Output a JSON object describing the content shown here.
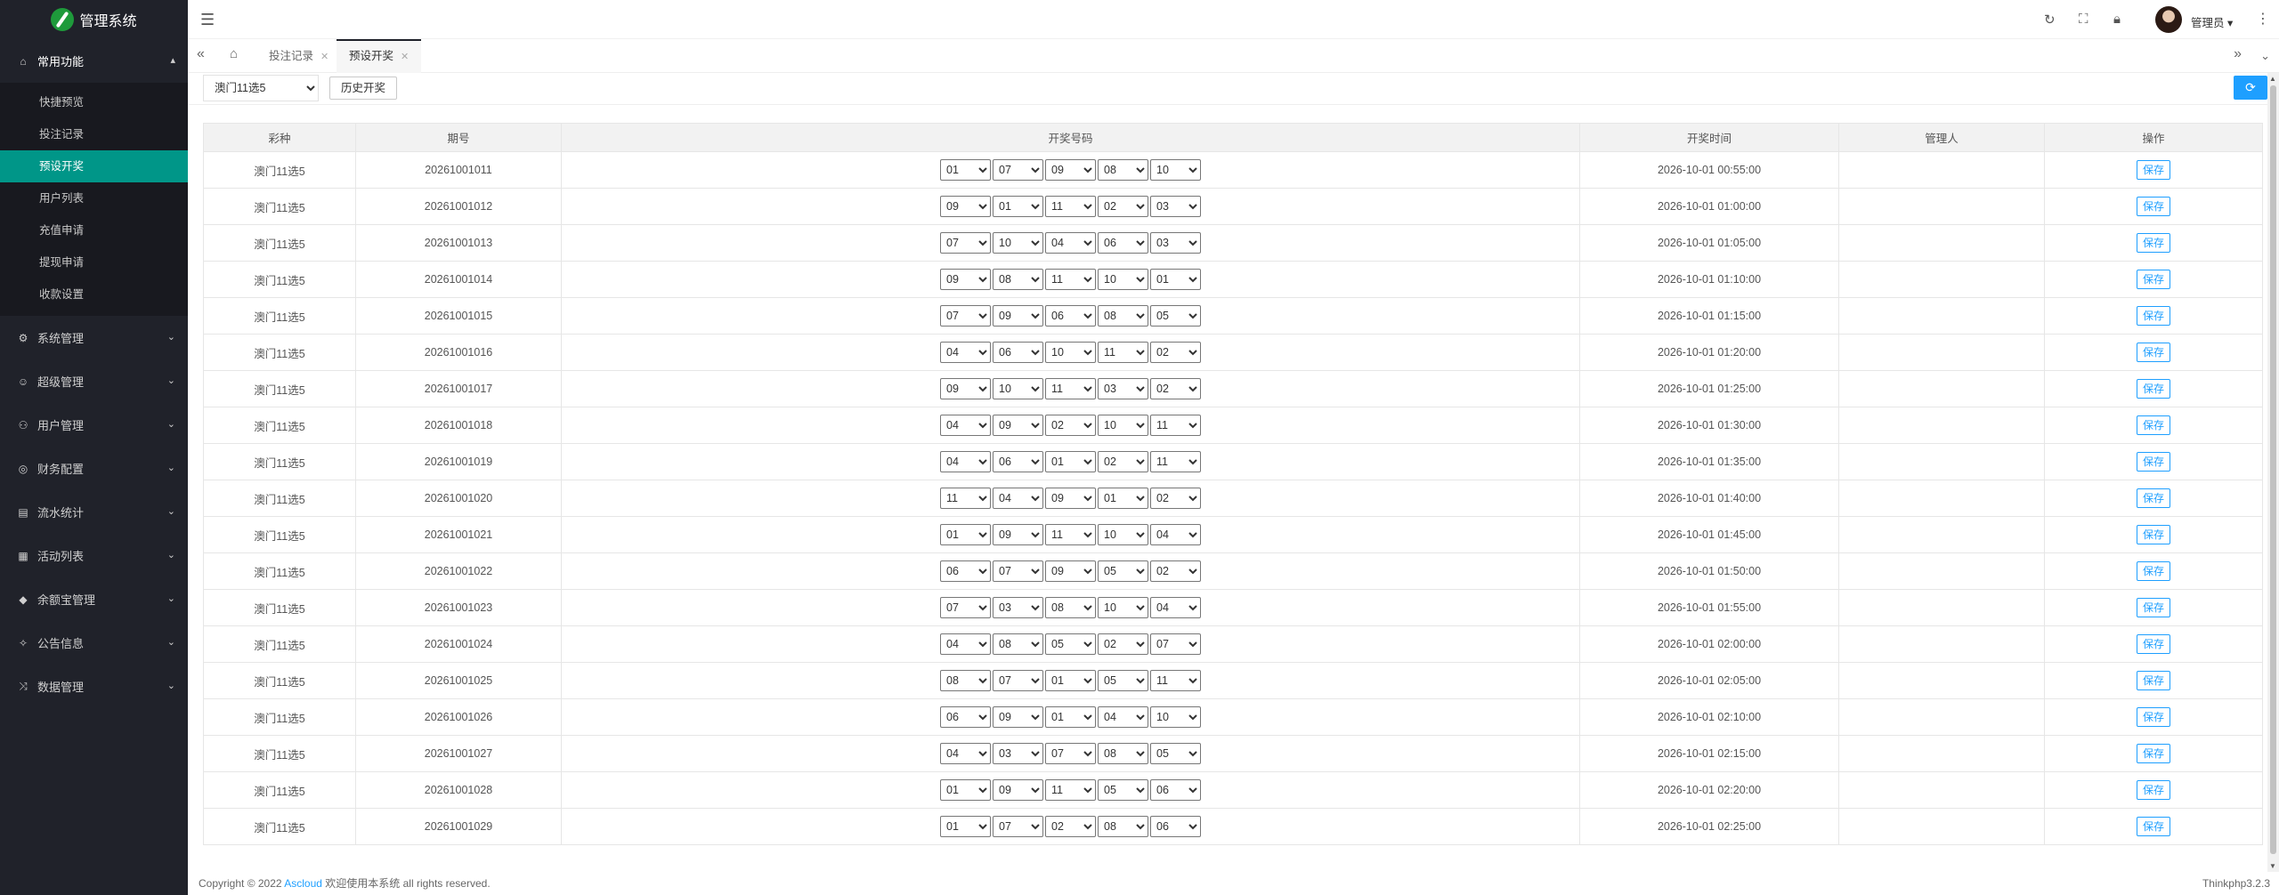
{
  "app": {
    "title": "管理系统"
  },
  "sidebar": {
    "open_group": {
      "label": "常用功能",
      "icon": "home-icon"
    },
    "sub_items": [
      {
        "label": "快捷预览"
      },
      {
        "label": "投注记录"
      },
      {
        "label": "预设开奖",
        "active": true
      },
      {
        "label": "用户列表"
      },
      {
        "label": "充值申请"
      },
      {
        "label": "提现申请"
      },
      {
        "label": "收款设置"
      }
    ],
    "groups": [
      {
        "label": "系统管理",
        "icon": "gear-icon"
      },
      {
        "label": "超级管理",
        "icon": "user-icon"
      },
      {
        "label": "用户管理",
        "icon": "users-icon"
      },
      {
        "label": "财务配置",
        "icon": "finance-icon"
      },
      {
        "label": "流水统计",
        "icon": "stats-icon"
      },
      {
        "label": "活动列表",
        "icon": "calendar-icon"
      },
      {
        "label": "余额宝管理",
        "icon": "diamond-icon"
      },
      {
        "label": "公告信息",
        "icon": "notice-icon"
      },
      {
        "label": "数据管理",
        "icon": "data-icon"
      }
    ]
  },
  "header": {
    "admin_label": "管理员"
  },
  "tabs": [
    {
      "label": "投注记录"
    },
    {
      "label": "预设开奖",
      "active": true
    }
  ],
  "toolbar": {
    "lottery_selected": "澳门11选5",
    "history_label": "历史开奖"
  },
  "table": {
    "headers": [
      "彩种",
      "期号",
      "开奖号码",
      "开奖时间",
      "管理人",
      "操作"
    ],
    "save_label": "保存",
    "rows": [
      {
        "game": "澳门11选5",
        "period": "20261001011",
        "numbers": [
          "01",
          "07",
          "09",
          "08",
          "10"
        ],
        "time": "2026-10-01 00:55:00",
        "admin": ""
      },
      {
        "game": "澳门11选5",
        "period": "20261001012",
        "numbers": [
          "09",
          "01",
          "11",
          "02",
          "03"
        ],
        "time": "2026-10-01 01:00:00",
        "admin": ""
      },
      {
        "game": "澳门11选5",
        "period": "20261001013",
        "numbers": [
          "07",
          "10",
          "04",
          "06",
          "03"
        ],
        "time": "2026-10-01 01:05:00",
        "admin": ""
      },
      {
        "game": "澳门11选5",
        "period": "20261001014",
        "numbers": [
          "09",
          "08",
          "11",
          "10",
          "01"
        ],
        "time": "2026-10-01 01:10:00",
        "admin": ""
      },
      {
        "game": "澳门11选5",
        "period": "20261001015",
        "numbers": [
          "07",
          "09",
          "06",
          "08",
          "05"
        ],
        "time": "2026-10-01 01:15:00",
        "admin": ""
      },
      {
        "game": "澳门11选5",
        "period": "20261001016",
        "numbers": [
          "04",
          "06",
          "10",
          "11",
          "02"
        ],
        "time": "2026-10-01 01:20:00",
        "admin": ""
      },
      {
        "game": "澳门11选5",
        "period": "20261001017",
        "numbers": [
          "09",
          "10",
          "11",
          "03",
          "02"
        ],
        "time": "2026-10-01 01:25:00",
        "admin": ""
      },
      {
        "game": "澳门11选5",
        "period": "20261001018",
        "numbers": [
          "04",
          "09",
          "02",
          "10",
          "11"
        ],
        "time": "2026-10-01 01:30:00",
        "admin": ""
      },
      {
        "game": "澳门11选5",
        "period": "20261001019",
        "numbers": [
          "04",
          "06",
          "01",
          "02",
          "11"
        ],
        "time": "2026-10-01 01:35:00",
        "admin": ""
      },
      {
        "game": "澳门11选5",
        "period": "20261001020",
        "numbers": [
          "11",
          "04",
          "09",
          "01",
          "02"
        ],
        "time": "2026-10-01 01:40:00",
        "admin": ""
      },
      {
        "game": "澳门11选5",
        "period": "20261001021",
        "numbers": [
          "01",
          "09",
          "11",
          "10",
          "04"
        ],
        "time": "2026-10-01 01:45:00",
        "admin": ""
      },
      {
        "game": "澳门11选5",
        "period": "20261001022",
        "numbers": [
          "06",
          "07",
          "09",
          "05",
          "02"
        ],
        "time": "2026-10-01 01:50:00",
        "admin": ""
      },
      {
        "game": "澳门11选5",
        "period": "20261001023",
        "numbers": [
          "07",
          "03",
          "08",
          "10",
          "04"
        ],
        "time": "2026-10-01 01:55:00",
        "admin": ""
      },
      {
        "game": "澳门11选5",
        "period": "20261001024",
        "numbers": [
          "04",
          "08",
          "05",
          "02",
          "07"
        ],
        "time": "2026-10-01 02:00:00",
        "admin": ""
      },
      {
        "game": "澳门11选5",
        "period": "20261001025",
        "numbers": [
          "08",
          "07",
          "01",
          "05",
          "11"
        ],
        "time": "2026-10-01 02:05:00",
        "admin": ""
      },
      {
        "game": "澳门11选5",
        "period": "20261001026",
        "numbers": [
          "06",
          "09",
          "01",
          "04",
          "10"
        ],
        "time": "2026-10-01 02:10:00",
        "admin": ""
      },
      {
        "game": "澳门11选5",
        "period": "20261001027",
        "numbers": [
          "04",
          "03",
          "07",
          "08",
          "05"
        ],
        "time": "2026-10-01 02:15:00",
        "admin": ""
      },
      {
        "game": "澳门11选5",
        "period": "20261001028",
        "numbers": [
          "01",
          "09",
          "11",
          "05",
          "06"
        ],
        "time": "2026-10-01 02:20:00",
        "admin": ""
      },
      {
        "game": "澳门11选5",
        "period": "20261001029",
        "numbers": [
          "01",
          "07",
          "02",
          "08",
          "06"
        ],
        "time": "2026-10-01 02:25:00",
        "admin": ""
      }
    ]
  },
  "footer": {
    "copyright_prefix": "Copyright © 2022",
    "brand": "Ascloud",
    "copyright_suffix": "欢迎使用本系统 all rights reserved.",
    "version": "Thinkphp3.2.3"
  },
  "colors": {
    "accent": "#009688",
    "primary": "#1e9fff",
    "sidebar_bg": "#20222a"
  }
}
